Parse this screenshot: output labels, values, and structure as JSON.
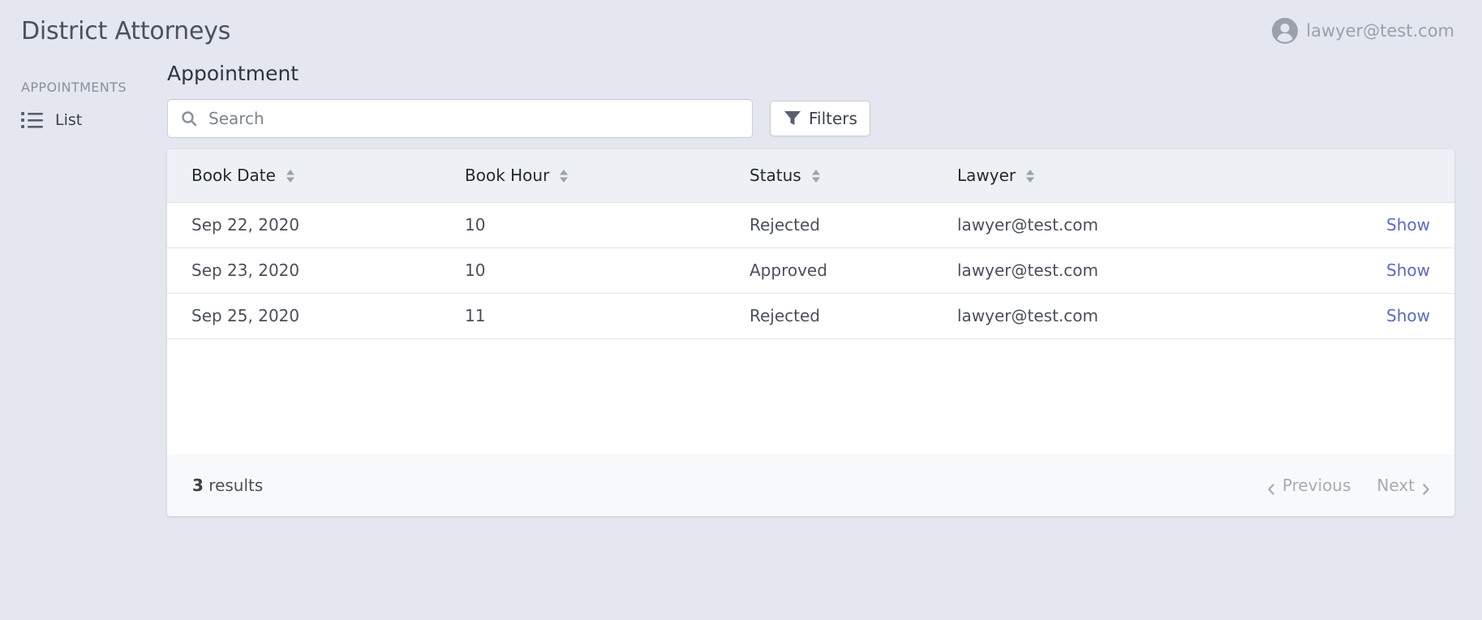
{
  "app": {
    "title": "District Attorneys"
  },
  "user": {
    "email": "lawyer@test.com",
    "icon": "user-circle-icon"
  },
  "sidebar": {
    "section": "APPOINTMENTS",
    "items": [
      {
        "label": "List",
        "icon": "list-icon"
      }
    ]
  },
  "main": {
    "title": "Appointment",
    "search": {
      "placeholder": "Search",
      "value": ""
    },
    "filters_label": "Filters",
    "table": {
      "columns": [
        "Book Date",
        "Book Hour",
        "Status",
        "Lawyer"
      ],
      "rows": [
        {
          "book_date": "Sep 22, 2020",
          "book_hour": "10",
          "status": "Rejected",
          "lawyer": "lawyer@test.com",
          "action": "Show"
        },
        {
          "book_date": "Sep 23, 2020",
          "book_hour": "10",
          "status": "Approved",
          "lawyer": "lawyer@test.com",
          "action": "Show"
        },
        {
          "book_date": "Sep 25, 2020",
          "book_hour": "11",
          "status": "Rejected",
          "lawyer": "lawyer@test.com",
          "action": "Show"
        }
      ]
    },
    "footer": {
      "count": "3",
      "results_label": "results",
      "previous_label": "Previous",
      "next_label": "Next"
    }
  },
  "colors": {
    "background": "#e4e7ef",
    "accent_link": "#5a6bc2",
    "header_row": "#edf1f6"
  }
}
